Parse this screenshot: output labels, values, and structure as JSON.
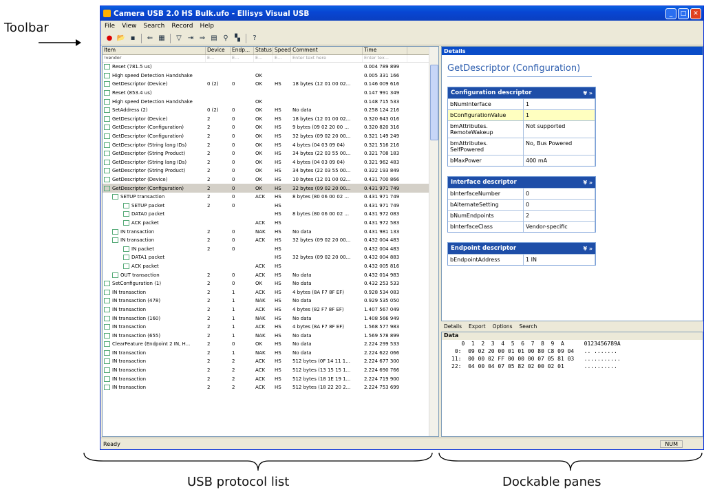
{
  "annotations": {
    "toolbar": "Toolbar",
    "list": "USB protocol list",
    "panes": "Dockable panes"
  },
  "window": {
    "title": "Camera USB 2.0 HS Bulk.ufo - Ellisys Visual USB",
    "menu": [
      "File",
      "View",
      "Search",
      "Record",
      "Help"
    ]
  },
  "list": {
    "columns": [
      "Item",
      "Device",
      "Endp...",
      "Status",
      "Speed",
      "Comment",
      "Time"
    ],
    "filter": [
      "!vendor",
      "E...",
      "E...",
      "E...",
      "E...",
      "Enter text here",
      "Enter tex..."
    ],
    "rows": [
      [
        "Reset (781.5 us)",
        "",
        "",
        "",
        "",
        "",
        "0.004 789 899"
      ],
      [
        "High speed Detection Handshake",
        "",
        "",
        "OK",
        "",
        "",
        "0.005 331 166"
      ],
      [
        "GetDescriptor (Device)",
        "0 (2)",
        "0",
        "OK",
        "HS",
        "18 bytes (12 01 00 02...",
        "0.146 009 616"
      ],
      [
        "Reset (853.4 us)",
        "",
        "",
        "",
        "",
        "",
        "0.147 991 349"
      ],
      [
        "High speed Detection Handshake",
        "",
        "",
        "OK",
        "",
        "",
        "0.148 715 533"
      ],
      [
        "SetAddress (2)",
        "0 (2)",
        "0",
        "OK",
        "HS",
        "No data",
        "0.258 124 216"
      ],
      [
        "GetDescriptor (Device)",
        "2",
        "0",
        "OK",
        "HS",
        "18 bytes (12 01 00 02...",
        "0.320 643 016"
      ],
      [
        "GetDescriptor (Configuration)",
        "2",
        "0",
        "OK",
        "HS",
        "9 bytes (09 02 20 00 ...",
        "0.320 820 316"
      ],
      [
        "GetDescriptor (Configuration)",
        "2",
        "0",
        "OK",
        "HS",
        "32 bytes (09 02 20 00...",
        "0.321 149 249"
      ],
      [
        "GetDescriptor (String lang IDs)",
        "2",
        "0",
        "OK",
        "HS",
        "4 bytes (04 03 09 04)",
        "0.321 516 216"
      ],
      [
        "GetDescriptor (String Product)",
        "2",
        "0",
        "OK",
        "HS",
        "34 bytes (22 03 55 00...",
        "0.321 708 183"
      ],
      [
        "GetDescriptor (String lang IDs)",
        "2",
        "0",
        "OK",
        "HS",
        "4 bytes (04 03 09 04)",
        "0.321 962 483"
      ],
      [
        "GetDescriptor (String Product)",
        "2",
        "0",
        "OK",
        "HS",
        "34 bytes (22 03 55 00...",
        "0.322 193 849"
      ],
      [
        "GetDescriptor (Device)",
        "2",
        "0",
        "OK",
        "HS",
        "10 bytes (12 01 00 02...",
        "0.431 700 866"
      ],
      [
        "GetDescriptor (Configuration)",
        "2",
        "0",
        "OK",
        "HS",
        "32 bytes (09 02 20 00...",
        "0.431 971 749"
      ],
      [
        "SETUP transaction",
        "2",
        "0",
        "ACK",
        "HS",
        "8 bytes (80 06 00 02 ...",
        "0.431 971 749"
      ],
      [
        "SETUP packet",
        "2",
        "0",
        "",
        "HS",
        "",
        "0.431 971 749"
      ],
      [
        "DATA0 packet",
        "",
        "",
        "",
        "HS",
        "8 bytes (80 06 00 02 ...",
        "0.431 972 083"
      ],
      [
        "ACK packet",
        "",
        "",
        "ACK",
        "HS",
        "",
        "0.431 972 583"
      ],
      [
        "IN transaction",
        "2",
        "0",
        "NAK",
        "HS",
        "No data",
        "0.431 981 133"
      ],
      [
        "IN transaction",
        "2",
        "0",
        "ACK",
        "HS",
        "32 bytes (09 02 20 00...",
        "0.432 004 483"
      ],
      [
        "IN packet",
        "2",
        "0",
        "",
        "HS",
        "",
        "0.432 004 483"
      ],
      [
        "DATA1 packet",
        "",
        "",
        "",
        "HS",
        "32 bytes (09 02 20 00...",
        "0.432 004 883"
      ],
      [
        "ACK packet",
        "",
        "",
        "ACK",
        "HS",
        "",
        "0.432 005 816"
      ],
      [
        "OUT transaction",
        "2",
        "0",
        "ACK",
        "HS",
        "No data",
        "0.432 014 983"
      ],
      [
        "SetConfiguration (1)",
        "2",
        "0",
        "OK",
        "HS",
        "No data",
        "0.432 253 533"
      ],
      [
        "IN transaction",
        "2",
        "1",
        "ACK",
        "HS",
        "4 bytes (8A F7 8F EF)",
        "0.928 534 083"
      ],
      [
        "IN transaction (478)",
        "2",
        "1",
        "NAK",
        "HS",
        "No data",
        "0.929 535 050"
      ],
      [
        "IN transaction",
        "2",
        "1",
        "ACK",
        "HS",
        "4 bytes (82 F7 8F EF)",
        "1.407 567 049"
      ],
      [
        "IN transaction (160)",
        "2",
        "1",
        "NAK",
        "HS",
        "No data",
        "1.408 566 949"
      ],
      [
        "IN transaction",
        "2",
        "1",
        "ACK",
        "HS",
        "4 bytes (8A F7 8F EF)",
        "1.568 577 983"
      ],
      [
        "IN transaction (655)",
        "2",
        "1",
        "NAK",
        "HS",
        "No data",
        "1.569 578 899"
      ],
      [
        "ClearFeature (Endpoint 2 IN, H...",
        "2",
        "0",
        "OK",
        "HS",
        "No data",
        "2.224 299 533"
      ],
      [
        "IN transaction",
        "2",
        "1",
        "NAK",
        "HS",
        "No data",
        "2.224 622 066"
      ],
      [
        "IN transaction",
        "2",
        "2",
        "ACK",
        "HS",
        "512 bytes (0F 14 11 1...",
        "2.224 677 300"
      ],
      [
        "IN transaction",
        "2",
        "2",
        "ACK",
        "HS",
        "512 bytes (13 15 15 1...",
        "2.224 690 766"
      ],
      [
        "IN transaction",
        "2",
        "2",
        "ACK",
        "HS",
        "512 bytes (18 1E 19 1...",
        "2.224 719 900"
      ],
      [
        "IN transaction",
        "2",
        "2",
        "ACK",
        "HS",
        "512 bytes (18 22 20 2...",
        "2.224 753 699"
      ]
    ]
  },
  "details": {
    "pane_title": "Details",
    "heading": "GetDescriptor (Configuration)",
    "sections": [
      {
        "title": "Configuration descriptor",
        "rows": [
          [
            "bNumInterface",
            "1"
          ],
          [
            "bConfigurationValue",
            "1"
          ],
          [
            "bmAttributes. RemoteWakeup",
            "Not supported"
          ],
          [
            "bmAttributes. SelfPowered",
            "No, Bus Powered"
          ],
          [
            "bMaxPower",
            "400 mA"
          ]
        ]
      },
      {
        "title": "Interface descriptor",
        "rows": [
          [
            "bInterfaceNumber",
            "0"
          ],
          [
            "bAlternateSetting",
            "0"
          ],
          [
            "bNumEndpoints",
            "2"
          ],
          [
            "bInterfaceClass",
            "Vendor-specific"
          ]
        ]
      },
      {
        "title": "Endpoint descriptor",
        "rows": [
          [
            "bEndpointAddress",
            "1 IN"
          ]
        ]
      }
    ],
    "tabs": [
      "Details",
      "Export",
      "Options",
      "Search"
    ]
  },
  "data": {
    "title": "Data",
    "header": "   0  1  2  3  4  5  6  7  8  9  A      0123456789A",
    "lines": [
      " 0:  09 02 20 00 01 01 00 80 C8 09 04   .. .......",
      "11:  00 00 02 FF 00 00 00 07 05 81 03   ...........",
      "22:  04 00 04 07 05 82 02 00 02 01      .........."
    ]
  },
  "status": {
    "left": "Ready",
    "num": "NUM"
  }
}
